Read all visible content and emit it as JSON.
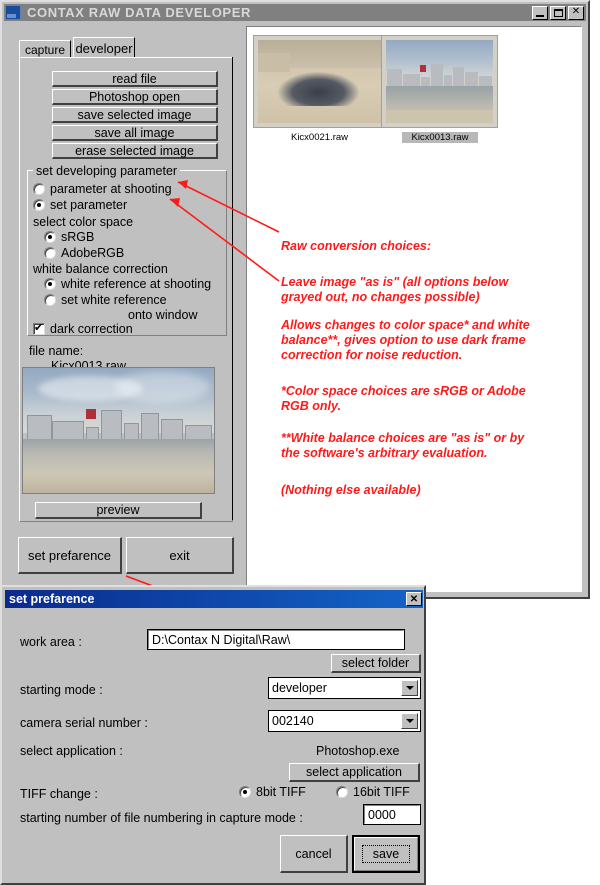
{
  "main_window": {
    "title": "CONTAX RAW DATA DEVELOPER",
    "icon": "app-icon",
    "minimize": "_",
    "maximize": "□",
    "close": "✕"
  },
  "tabs": [
    {
      "label": "capture",
      "active": false
    },
    {
      "label": "developer",
      "active": true
    }
  ],
  "actions": [
    {
      "label": "read file"
    },
    {
      "label": "Photoshop open"
    },
    {
      "label": "save selected image"
    },
    {
      "label": "save all image"
    },
    {
      "label": "erase selected image"
    }
  ],
  "develop_group": {
    "legend": "set developing parameter",
    "mode_options": [
      {
        "label": "parameter at shooting",
        "checked": false
      },
      {
        "label": "set parameter",
        "checked": true
      }
    ],
    "color_space_heading": "select color space",
    "color_space_options": [
      {
        "label": "sRGB",
        "checked": true
      },
      {
        "label": "AdobeRGB",
        "checked": false
      }
    ],
    "white_balance_heading": "white balance correction",
    "white_balance_options": [
      {
        "label": "white reference at shooting",
        "checked": true
      },
      {
        "label": "set white reference",
        "checked": false
      }
    ],
    "onto_window": "onto window",
    "dark_correction": {
      "label": "dark correction",
      "checked": true
    }
  },
  "file_info": {
    "label": "file name:",
    "value": "Kicx0013.raw"
  },
  "preview_button": "preview",
  "bottom_buttons": {
    "set_preference": "set prefarence",
    "exit": "exit"
  },
  "thumbnails": [
    {
      "caption": "Kicx0021.raw",
      "selected": false
    },
    {
      "caption": "Kicx0013.raw",
      "selected": true
    }
  ],
  "annotations": {
    "color": "#ff1a1a",
    "heading": "Raw conversion choices:",
    "note_as_is": "Leave image \"as is\"  (all options below\ngrayed out, no changes possible)",
    "note_allows": "Allows changes to color space* and white\nbalance**, gives option to use dark frame\ncorrection for noise reduction.",
    "note_colorspace": "*Color space choices are sRGB or Adobe\n  RGB only.",
    "note_whitebalance": "**White balance choices are \"as is\" or by\n  the software's arbitrary evaluation.",
    "note_nothing": "(Nothing else available)"
  },
  "pref_dialog": {
    "title": "set prefarence",
    "close": "✕",
    "work_area": {
      "label": "work area  :",
      "value": "D:\\Contax  N  Digital\\Raw\\"
    },
    "select_folder_button": "select folder",
    "starting_mode": {
      "label": "starting mode :",
      "value": "developer"
    },
    "camera_serial": {
      "label": "camera serial number :",
      "value": "002140"
    },
    "select_application": {
      "label": "select application :",
      "value": "Photoshop.exe",
      "button": "select application"
    },
    "tiff_change": {
      "label": "TIFF change :",
      "options": [
        {
          "label": "8bit TIFF",
          "checked": true
        },
        {
          "label": "16bit TIFF",
          "checked": false
        }
      ]
    },
    "start_number": {
      "label": "starting number of file numbering in capture mode :",
      "value": "0000"
    },
    "cancel_button": "cancel",
    "save_button": "save"
  }
}
